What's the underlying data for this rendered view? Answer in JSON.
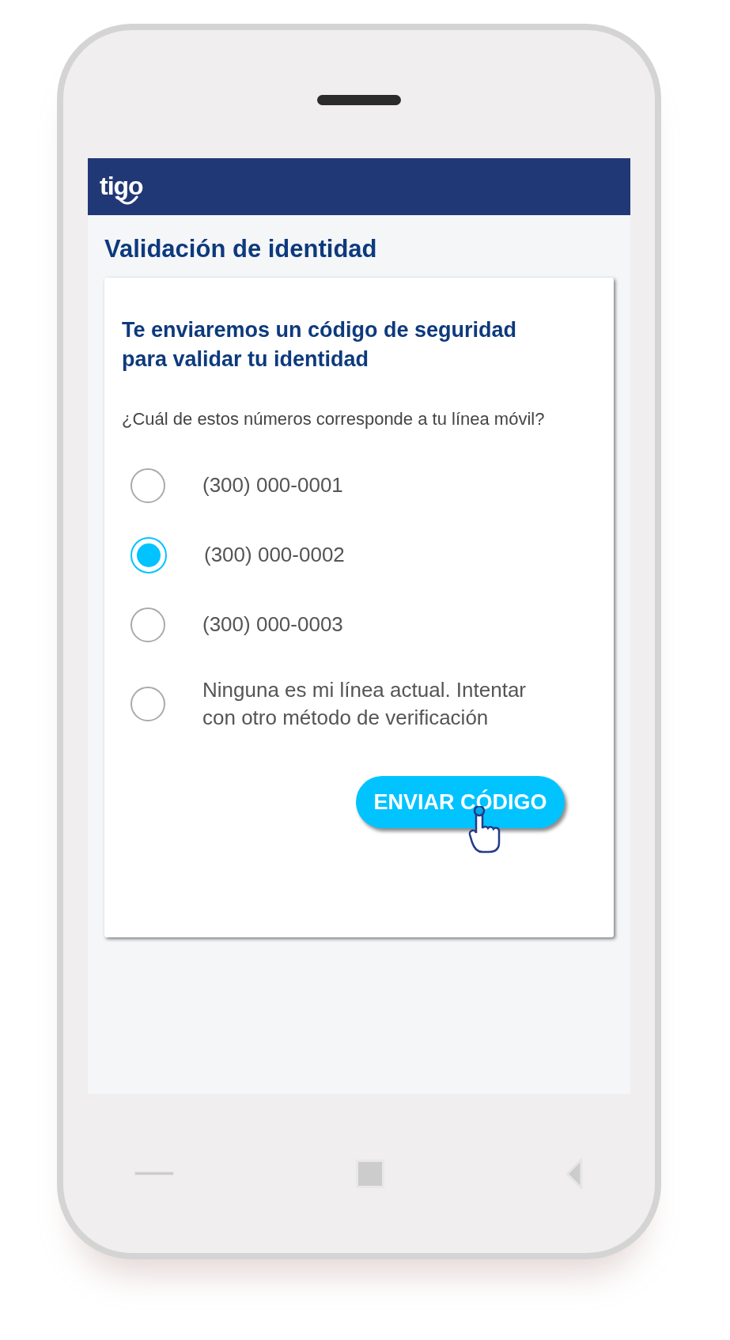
{
  "header": {
    "logo": "tigo"
  },
  "page_title": "Validación de identidad",
  "card": {
    "heading": "Te enviaremos un código de seguridad para validar tu identidad",
    "question": "¿Cuál de estos números corresponde a tu línea móvil?",
    "options": [
      {
        "label": "(300) 000-0001",
        "selected": false
      },
      {
        "label": "(300) 000-0002",
        "selected": true
      },
      {
        "label": "(300) 000-0003",
        "selected": false
      },
      {
        "label": "Ninguna es mi línea actual. Intentar con otro método de verificación",
        "selected": false
      }
    ],
    "button": "ENVIAR CÓDIGO"
  }
}
